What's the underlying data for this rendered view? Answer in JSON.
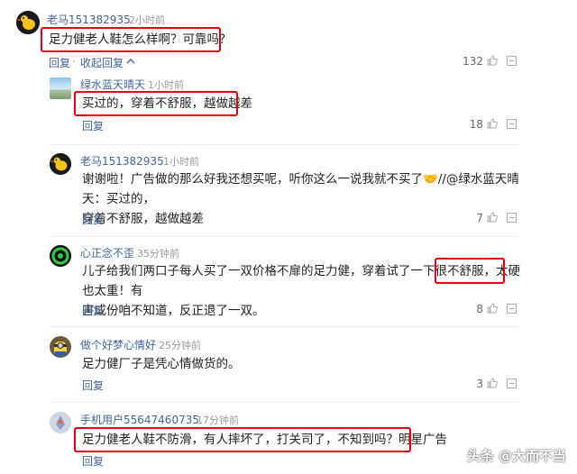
{
  "comment_main": {
    "username": "老马151382935",
    "time": "2小时前",
    "text": "足力健老人鞋怎么样啊？可靠吗？",
    "reply_label": "回复",
    "collapse_label": "收起回复",
    "separator": "·",
    "likes": "132"
  },
  "replies": [
    {
      "username": "绿水蓝天晴天",
      "time": "1小时前",
      "text": "买过的，穿着不舒服，越做越差",
      "reply_label": "回复",
      "likes": "18"
    },
    {
      "username": "老马151382935",
      "time": "1小时前",
      "text_line1": "谢谢啦！广告做的那么好我还想买呢，听你这么一说我就不买了",
      "emoji": "🤝",
      "text_line1_tail": "//@绿水蓝天晴天：买过的，",
      "text_line2": "穿着不舒服，越做越差",
      "reply_label": "回复",
      "likes": "7"
    },
    {
      "username": "心正念不歪",
      "time": "35分钟前",
      "text_part1": "儿子给我们两口子每人买了一双价格不扉的足力健，穿着试了一下很不舒服，",
      "text_highlight": "太硬也太重！",
      "text_part2": "有",
      "text_line2": "害成份咱不知道，反正退了一双。",
      "reply_label": "回复",
      "likes": "8"
    },
    {
      "username": "做个好梦心情好",
      "time": "25分钟前",
      "text": "足力健厂子是凭心情做货的。",
      "reply_label": "回复",
      "likes": "3"
    },
    {
      "username": "手机用户55647460735",
      "time": "17分钟前",
      "text": "足力健老人鞋不防滑，有人摔坏了，打关司了，不知到吗？明星广告",
      "reply_label": "回复"
    }
  ],
  "watermark": "头条 @大而不当",
  "colors": {
    "username": "#406599",
    "highlight_box": "#e60012",
    "meta": "#999999"
  },
  "icons": [
    "thumb-up-icon",
    "more-icon",
    "chevron-up-icon"
  ]
}
